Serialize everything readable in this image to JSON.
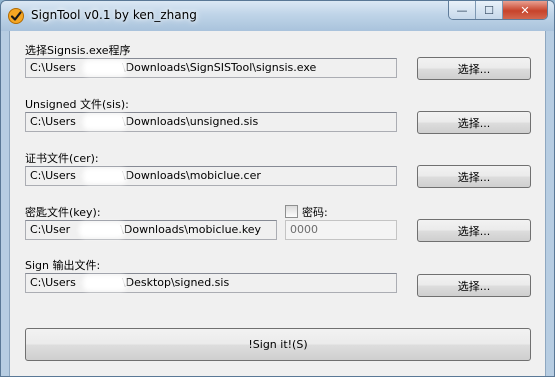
{
  "window": {
    "title": "SignTool v0.1 by ken_zhang",
    "caption_buttons": {
      "minimize": "—",
      "maximize": "☐",
      "close": "✕"
    }
  },
  "fields": [
    {
      "label": "选择Signsis.exe程序",
      "value_prefix": "C:\\Users",
      "value_suffix": "\\Downloads\\SignSISTool\\signsis.exe",
      "button": "选择..."
    },
    {
      "label": "Unsigned 文件(sis):",
      "value_prefix": "C:\\Users",
      "value_suffix": "\\Downloads\\unsigned.sis",
      "button": "选择..."
    },
    {
      "label": "证书文件(cer):",
      "value_prefix": "C:\\Users",
      "value_suffix": "\\Downloads\\mobiclue.cer",
      "button": "选择..."
    },
    {
      "label": "密匙文件(key):",
      "value_prefix": "C:\\User",
      "value_suffix": "\\Downloads\\mobiclue.key",
      "button": "选择..."
    },
    {
      "label": "Sign 输出文件:",
      "value_prefix": "C:\\Users",
      "value_suffix": "\\Desktop\\signed.sis",
      "button": "选择..."
    }
  ],
  "password": {
    "checkbox_label": "密码:",
    "checked": false,
    "value": "0000"
  },
  "sign_button": "!Sign it!(S)"
}
